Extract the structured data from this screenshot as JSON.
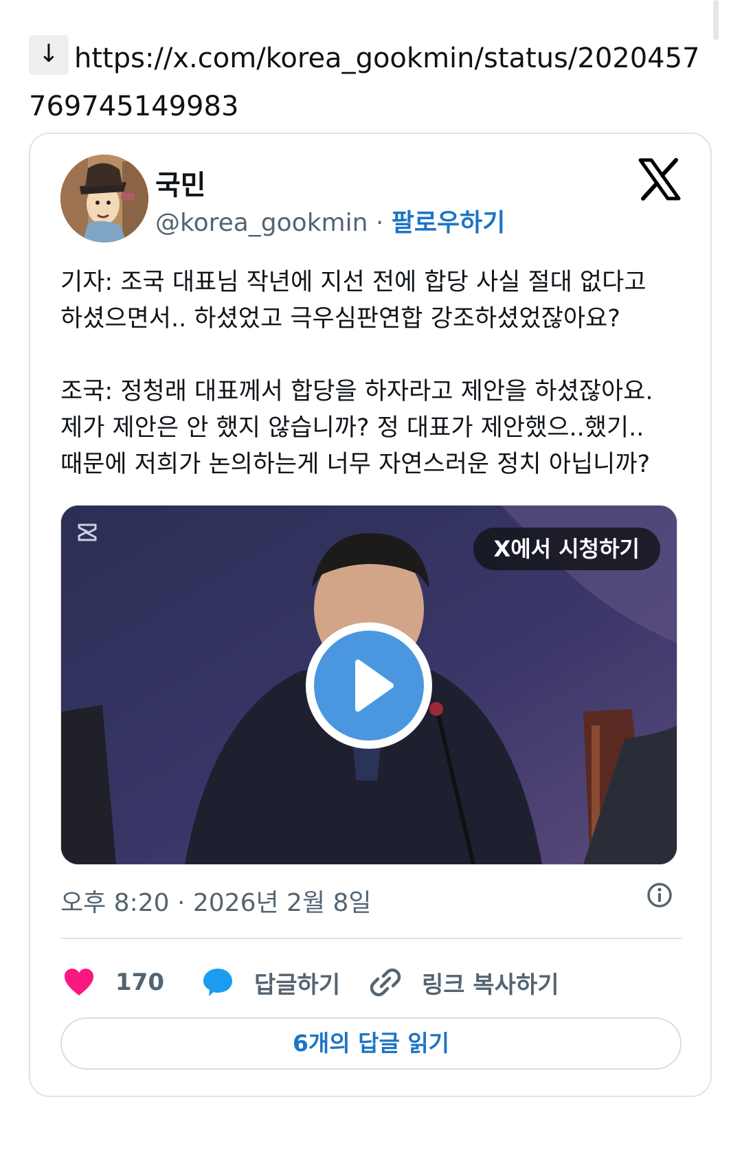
{
  "link": {
    "arrow": "↓",
    "url": "https://x.com/korea_gookmin/status/2020457769745149983"
  },
  "tweet": {
    "display_name": "국민",
    "handle": "@korea_gookmin",
    "separator": "·",
    "follow_label": "팔로우하기",
    "logo_icon": "x-logo-icon",
    "avatar_icon": "cartoon-avatar",
    "paragraph1": [
      "기자: 조국 대표님 작년에 지선 전에 합당 사실 절대 없다고",
      "하셨으면서.. 하셨었고 극우심판연합 강조하셨었잖아요?"
    ],
    "paragraph2": [
      "조국: 정청래 대표께서 합당을 하자라고 제안을 하셨잖아요.",
      "제가 제안은 안 했지 않습니까? 정 대표가 제안했으..했기..",
      "때문에 저희가 논의하는게 너무 자연스러운 정치 아닙니까?"
    ],
    "media": {
      "watch_label": "X에서 시청하기",
      "play_icon": "play-icon"
    },
    "timestamp": "오후 8:20 · 2026년 2월 8일",
    "actions": {
      "like_count": "170",
      "reply_label": "답글하기",
      "copy_link_label": "링크 복사하기"
    },
    "read_replies_label": "6개의 답글 읽기"
  },
  "colors": {
    "link_blue": "#1d74c4",
    "like_pink": "#f91880",
    "reply_blue": "#1d9bf0",
    "play_blue": "#4a97e0",
    "muted_text": "#536471"
  }
}
